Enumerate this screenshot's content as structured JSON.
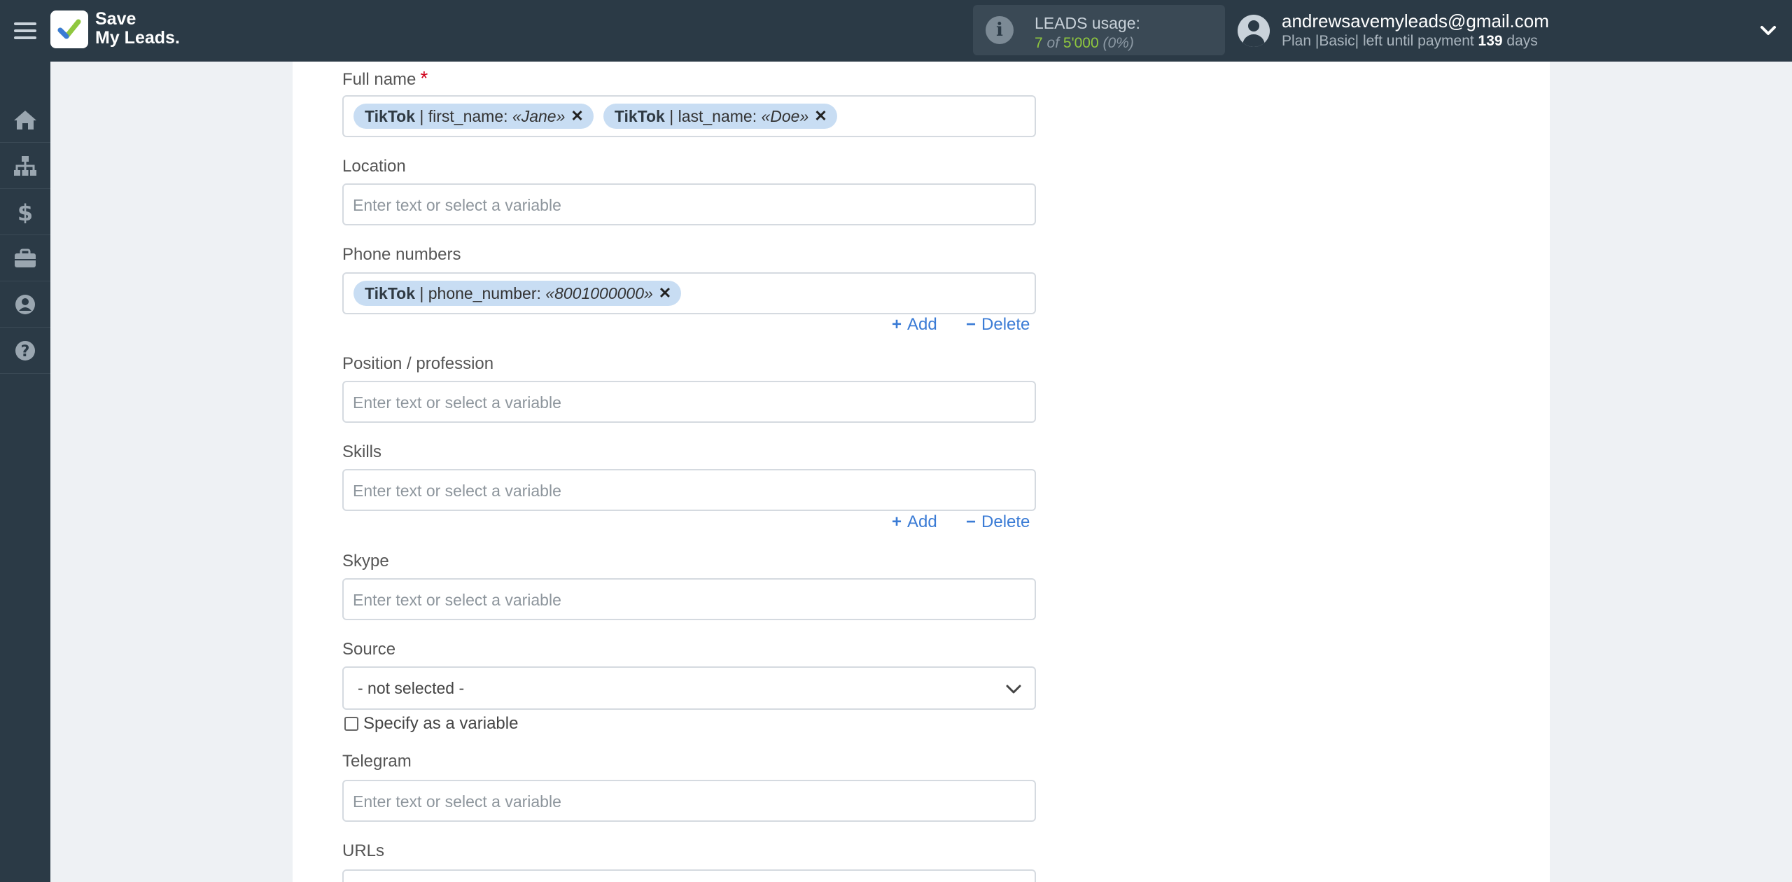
{
  "header": {
    "brand_line1": "Save",
    "brand_line2": "My Leads",
    "usage_title": "LEADS usage:",
    "usage_used": "7",
    "usage_of": "of",
    "usage_total": "5'000",
    "usage_percent": "(0%)",
    "account_email": "andrewsavemyleads@gmail.com",
    "plan_prefix": "Plan |Basic| left until payment ",
    "plan_days": "139",
    "plan_suffix": " days"
  },
  "sidebar": {
    "items": [
      {
        "name": "home-icon"
      },
      {
        "name": "sitemap-icon"
      },
      {
        "name": "dollar-icon"
      },
      {
        "name": "briefcase-icon"
      },
      {
        "name": "user-circle-icon"
      },
      {
        "name": "help-icon"
      }
    ]
  },
  "form": {
    "full_name": {
      "label": "Full name",
      "required_mark": "*",
      "tags": [
        {
          "source": "TikTok",
          "field": " | first_name: ",
          "value": "«Jane»"
        },
        {
          "source": "TikTok",
          "field": " | last_name: ",
          "value": "«Doe»"
        }
      ]
    },
    "location": {
      "label": "Location",
      "placeholder": "Enter text or select a variable"
    },
    "phone_numbers": {
      "label": "Phone numbers",
      "tags": [
        {
          "source": "TikTok",
          "field": " | phone_number: ",
          "value": "«8001000000»"
        }
      ],
      "add_label": "Add",
      "delete_label": "Delete"
    },
    "position": {
      "label": "Position / profession",
      "placeholder": "Enter text or select a variable"
    },
    "skills": {
      "label": "Skills",
      "placeholder": "Enter text or select a variable",
      "add_label": "Add",
      "delete_label": "Delete"
    },
    "skype": {
      "label": "Skype",
      "placeholder": "Enter text or select a variable"
    },
    "source": {
      "label": "Source",
      "selected": "- not selected -",
      "specify_label": "Specify as a variable"
    },
    "telegram": {
      "label": "Telegram",
      "placeholder": "Enter text or select a variable"
    },
    "urls": {
      "label": "URLs"
    }
  },
  "colors": {
    "topbar": "#2b3a46",
    "accent_green": "#8fc73e",
    "link_blue": "#3a7bd5",
    "chip_bg": "#c8ddf3",
    "required_red": "#d0021b"
  }
}
